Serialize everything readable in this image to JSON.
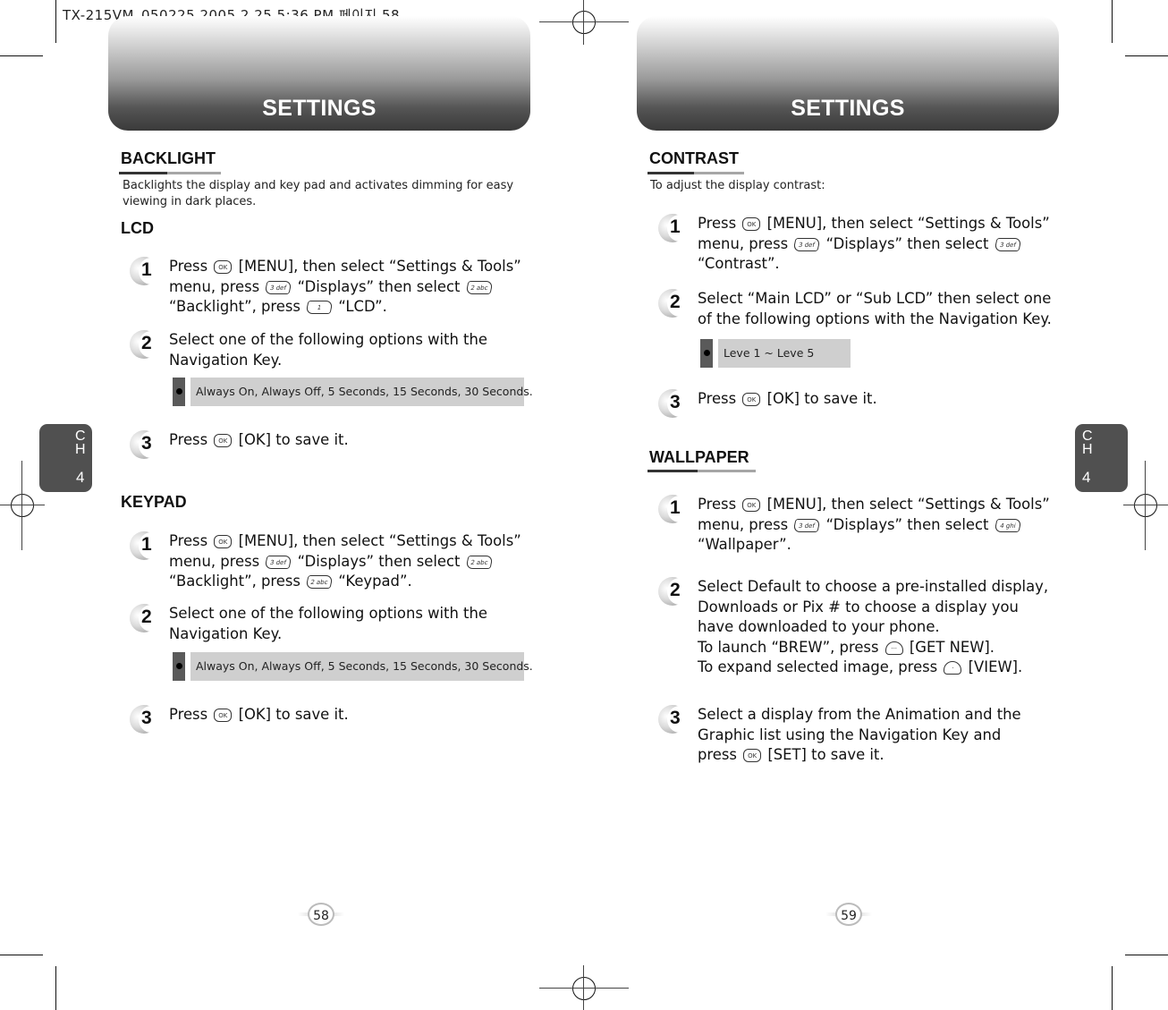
{
  "slug": "TX-215VM_050225  2005.2.25 5:36 PM 페이지 58",
  "left_page": {
    "header_title": "SETTINGS",
    "chapter_tab": {
      "letters": "C\nH",
      "number": "4"
    },
    "page_number": "58",
    "backlight": {
      "title": "BACKLIGHT",
      "description_line1": "Backlights the display and key pad and activates dimming for easy",
      "description_line2": "viewing in dark places.",
      "lcd": {
        "title": "LCD",
        "steps": [
          {
            "num": "1",
            "lines": [
              {
                "parts": [
                  "Press ",
                  {
                    "key": "ok",
                    "label": "OK"
                  },
                  " [MENU], then select “Settings & Tools”"
                ]
              },
              {
                "parts": [
                  "menu, press ",
                  {
                    "key": "num",
                    "label": "3 def"
                  },
                  " “Displays” then select ",
                  {
                    "key": "num",
                    "label": "2 abc"
                  }
                ]
              },
              {
                "parts": [
                  "“Backlight”, press ",
                  {
                    "key": "num",
                    "label": "1"
                  },
                  " “LCD”."
                ]
              }
            ]
          },
          {
            "num": "2",
            "lines": [
              {
                "parts": [
                  "Select one of the following options with the"
                ]
              },
              {
                "parts": [
                  "Navigation Key."
                ]
              }
            ]
          },
          {
            "num": "3",
            "lines": [
              {
                "parts": [
                  "Press ",
                  {
                    "key": "ok",
                    "label": "OK"
                  },
                  "  [OK] to save it."
                ]
              }
            ]
          }
        ],
        "options": "Always On, Always Off, 5 Seconds, 15 Seconds, 30 Seconds."
      }
    },
    "keypad": {
      "title": "KEYPAD",
      "steps": [
        {
          "num": "1",
          "lines": [
            {
              "parts": [
                "Press ",
                {
                  "key": "ok",
                  "label": "OK"
                },
                " [MENU], then select “Settings & Tools”"
              ]
            },
            {
              "parts": [
                "menu, press ",
                {
                  "key": "num",
                  "label": "3 def"
                },
                " “Displays” then select ",
                {
                  "key": "num",
                  "label": "2 abc"
                }
              ]
            },
            {
              "parts": [
                "“Backlight”, press ",
                {
                  "key": "num",
                  "label": "2 abc"
                },
                " “Keypad”."
              ]
            }
          ]
        },
        {
          "num": "2",
          "lines": [
            {
              "parts": [
                "Select one of the following options with the"
              ]
            },
            {
              "parts": [
                "Navigation Key."
              ]
            }
          ]
        },
        {
          "num": "3",
          "lines": [
            {
              "parts": [
                "Press ",
                {
                  "key": "ok",
                  "label": "OK"
                },
                "  [OK] to save it."
              ]
            }
          ]
        }
      ],
      "options": "Always On, Always Off, 5 Seconds, 15 Seconds, 30 Seconds."
    }
  },
  "right_page": {
    "header_title": "SETTINGS",
    "chapter_tab": {
      "letters": "C\nH",
      "number": "4"
    },
    "page_number": "59",
    "contrast": {
      "title": "CONTRAST",
      "description": "To adjust the display contrast:",
      "steps": [
        {
          "num": "1",
          "lines": [
            {
              "parts": [
                "Press ",
                {
                  "key": "ok",
                  "label": "OK"
                },
                " [MENU], then select “Settings & Tools”"
              ]
            },
            {
              "parts": [
                "menu, press ",
                {
                  "key": "num",
                  "label": "3 def"
                },
                " “Displays” then select ",
                {
                  "key": "num",
                  "label": "3 def"
                }
              ]
            },
            {
              "parts": [
                "“Contrast”."
              ]
            }
          ]
        },
        {
          "num": "2",
          "lines": [
            {
              "parts": [
                "Select “Main LCD” or “Sub LCD” then select one"
              ]
            },
            {
              "parts": [
                "of the following options with the Navigation Key."
              ]
            }
          ]
        },
        {
          "num": "3",
          "lines": [
            {
              "parts": [
                "Press ",
                {
                  "key": "ok",
                  "label": "OK"
                },
                "  [OK] to save it."
              ]
            }
          ]
        }
      ],
      "options": "Leve 1 ~ Leve 5"
    },
    "wallpaper": {
      "title": "WALLPAPER",
      "steps": [
        {
          "num": "1",
          "lines": [
            {
              "parts": [
                "Press ",
                {
                  "key": "ok",
                  "label": "OK"
                },
                " [MENU], then select “Settings & Tools”"
              ]
            },
            {
              "parts": [
                "menu, press ",
                {
                  "key": "num",
                  "label": "3 def"
                },
                " “Displays” then select ",
                {
                  "key": "num",
                  "label": "4 ghi"
                }
              ]
            },
            {
              "parts": [
                "“Wallpaper”."
              ]
            }
          ]
        },
        {
          "num": "2",
          "lines": [
            {
              "parts": [
                "Select Default to choose a pre-installed display,"
              ]
            },
            {
              "parts": [
                "Downloads or Pix # to choose a display you"
              ]
            },
            {
              "parts": [
                "have downloaded to your phone."
              ]
            },
            {
              "parts": [
                "To launch “BREW”, press ",
                {
                  "key": "soft",
                  "label": "···"
                },
                " [GET NEW]."
              ]
            },
            {
              "parts": [
                "To expand selected image, press  ",
                {
                  "key": "soft",
                  "label": "·"
                },
                "  [VIEW]."
              ]
            }
          ]
        },
        {
          "num": "3",
          "lines": [
            {
              "parts": [
                "Select a display from the Animation and the"
              ]
            },
            {
              "parts": [
                "Graphic list using the Navigation Key and"
              ]
            },
            {
              "parts": [
                "press ",
                {
                  "key": "ok",
                  "label": "OK"
                },
                " [SET] to save it."
              ]
            }
          ]
        }
      ]
    }
  }
}
